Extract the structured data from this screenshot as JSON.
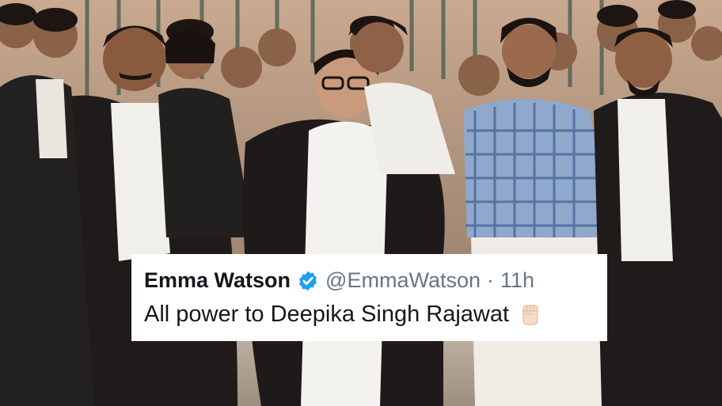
{
  "tweet": {
    "name": "Emma Watson",
    "handle": "@EmmaWatson",
    "separator": "·",
    "time": "11h",
    "text": "All power to Deepika Singh Rajawat",
    "emoji": "raised-fist-light-skin-icon"
  },
  "colors": {
    "verified_badge": "#1da1f2",
    "name_text": "#14171a",
    "meta_text": "#657786",
    "card_background": "#ffffff"
  }
}
